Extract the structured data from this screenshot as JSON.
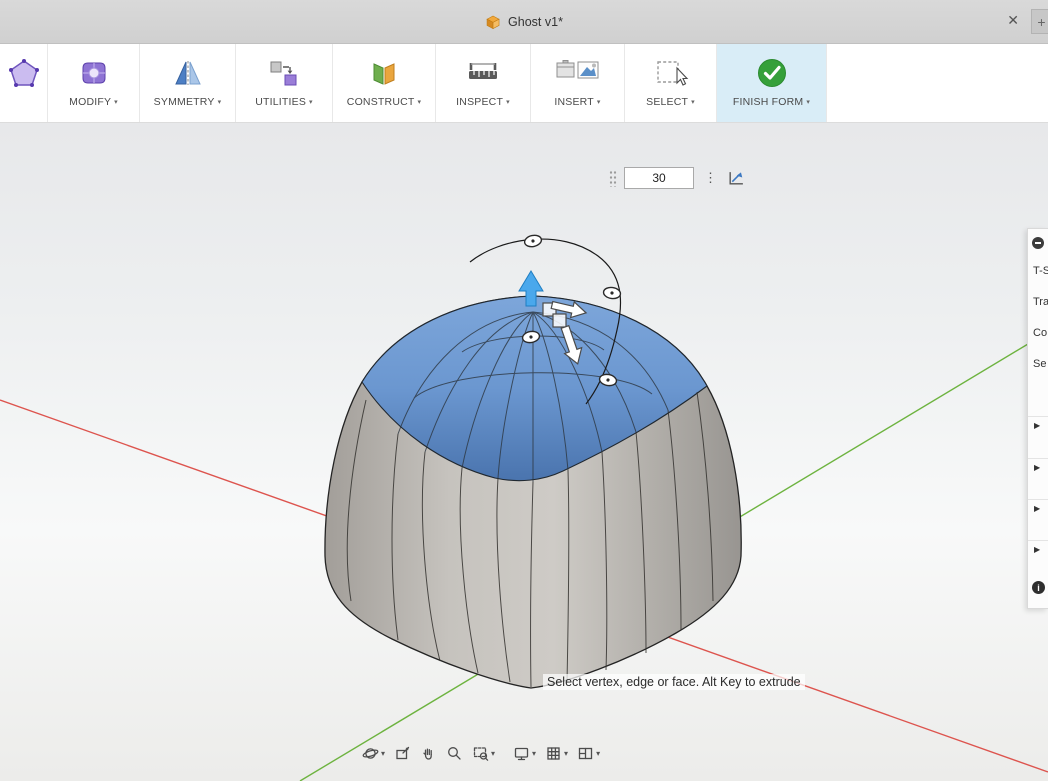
{
  "ui": {
    "caret": "▾"
  },
  "titlebar": {
    "title": "Ghost v1*",
    "close_glyph": "✕",
    "new_tab_glyph": "+"
  },
  "toolbar": {
    "groups": [
      {
        "label": "MODIFY"
      },
      {
        "label": "SYMMETRY"
      },
      {
        "label": "UTILITIES"
      },
      {
        "label": "CONSTRUCT"
      },
      {
        "label": "INSPECT"
      },
      {
        "label": "INSERT"
      },
      {
        "label": "SELECT"
      },
      {
        "label": "FINISH FORM"
      }
    ]
  },
  "canvas": {
    "offset_value": "30",
    "menu_glyph": "⋮",
    "hint": "Select vertex, edge or face. Alt Key to extrude"
  },
  "right_panel": {
    "items": [
      {
        "label": "T-S"
      },
      {
        "label": "Tra"
      },
      {
        "label": "Co"
      },
      {
        "label": "Se"
      }
    ],
    "expand_glyph": "▶",
    "info_glyph": "i"
  },
  "navbar": {
    "icons": [
      "orbit",
      "look-at",
      "pan",
      "zoom",
      "fit",
      "display-settings",
      "grid-and-snaps",
      "viewports"
    ]
  },
  "colors": {
    "axis_red": "#dd544e",
    "axis_green": "#6db33f",
    "selection_blue": "#5b8fd0",
    "finish_green": "#35a03a",
    "toolbar_highlight": "#d9edf7"
  }
}
